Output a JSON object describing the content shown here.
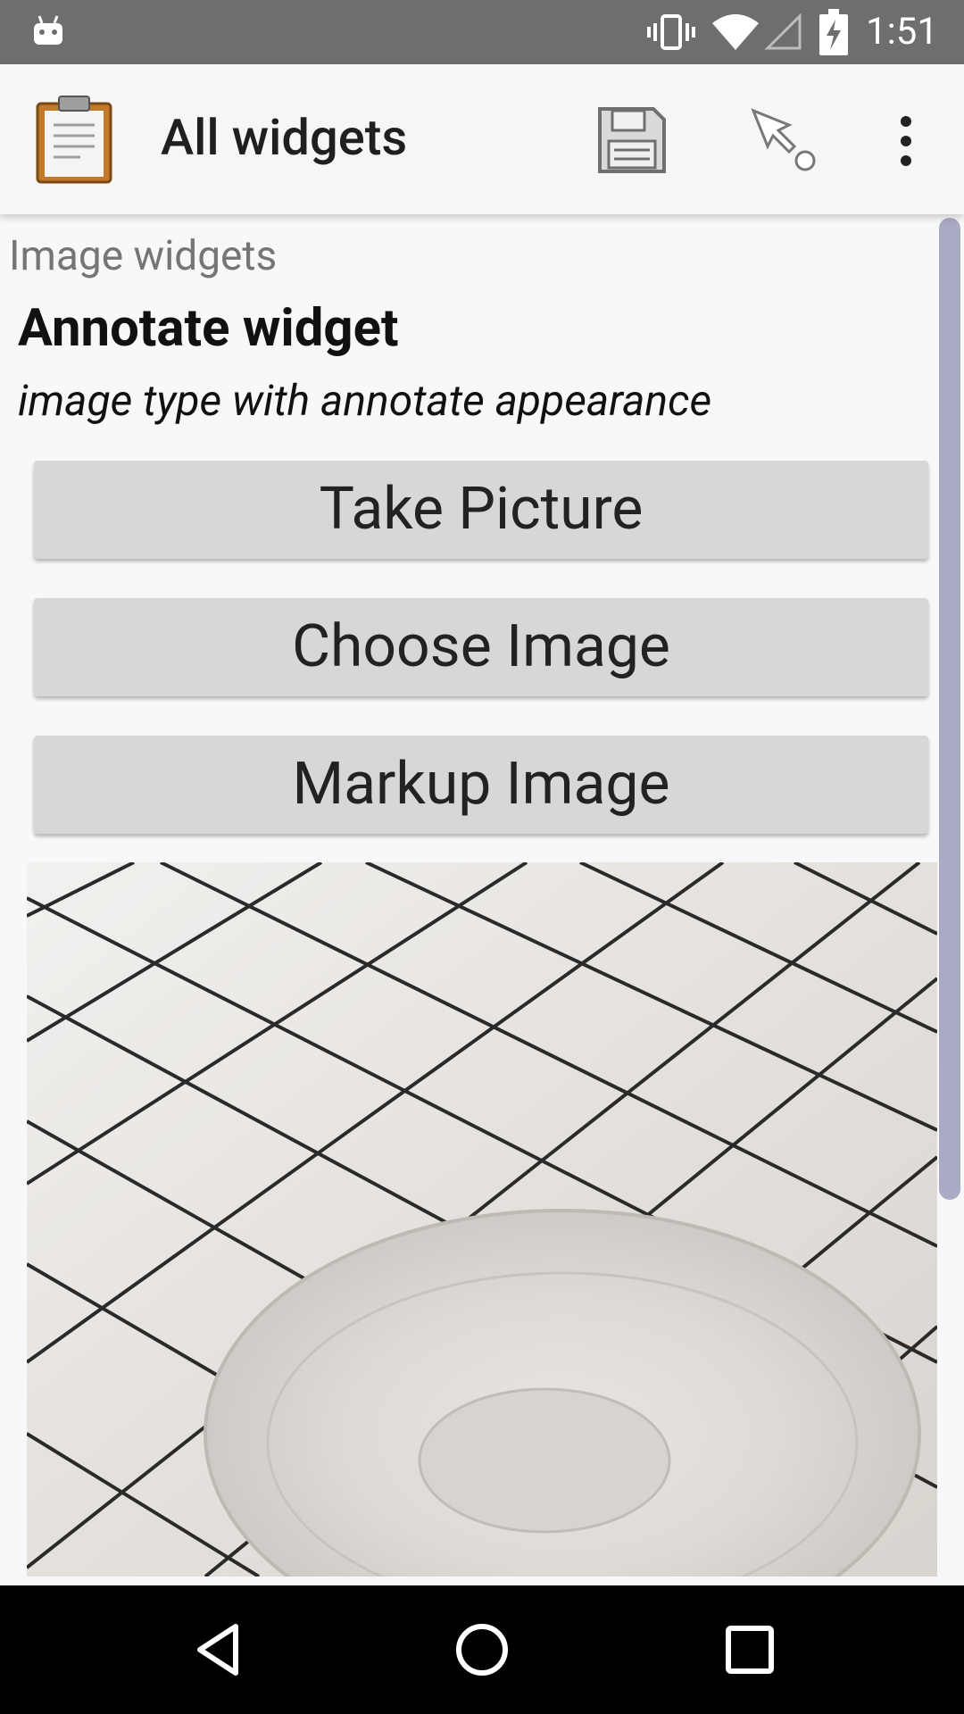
{
  "status_bar": {
    "time": "1:51",
    "icons": [
      "android-icon",
      "vibrate-icon",
      "wifi-icon",
      "signal-icon",
      "battery-charging-icon"
    ]
  },
  "app_bar": {
    "title": "All widgets",
    "icons": [
      "clipboard-app-icon",
      "save-icon",
      "goto-icon",
      "more-vert-icon"
    ]
  },
  "content": {
    "group_label": "Image widgets",
    "question_title": "Annotate widget",
    "question_hint": "image type with annotate appearance",
    "buttons": {
      "take_picture": "Take Picture",
      "choose_image": "Choose Image",
      "markup_image": "Markup Image"
    },
    "preview": {
      "icon": "image-preview"
    }
  },
  "nav_bar": {
    "icons": [
      "back-icon",
      "home-icon",
      "recents-icon"
    ]
  },
  "colors": {
    "status_bar": "#6e6e6e",
    "app_bar": "#f6f6f8",
    "button": "#d6d7d7",
    "scrollbar": "#a9abc4",
    "nav_bar": "#000000"
  }
}
